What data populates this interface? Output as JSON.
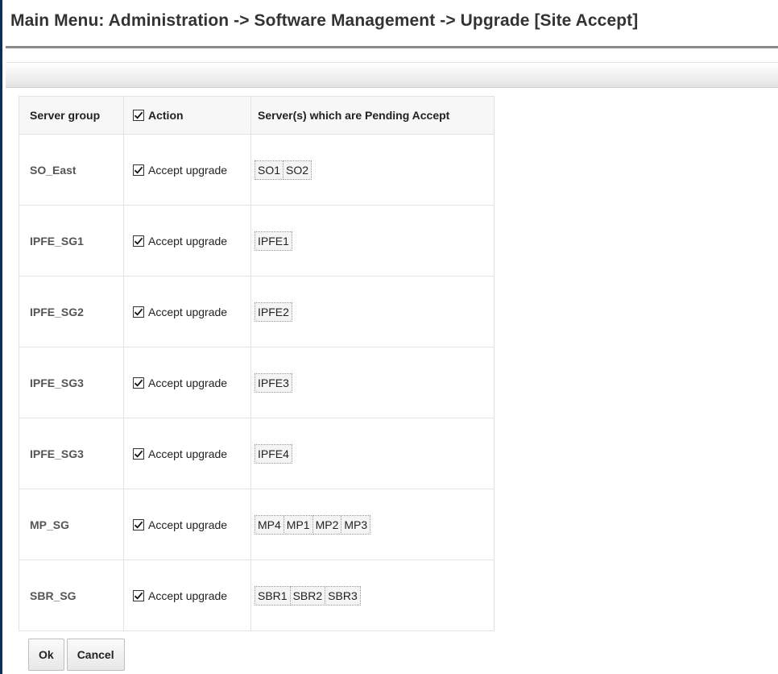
{
  "page": {
    "title": "Main Menu: Administration -> Software Management -> Upgrade [Site Accept]"
  },
  "table": {
    "headers": {
      "server_group": "Server group",
      "action": "Action",
      "pending": "Server(s) which are Pending Accept"
    },
    "header_action_checked": true,
    "rows": [
      {
        "group": "SO_East",
        "action_label": "Accept upgrade",
        "checked": true,
        "servers": [
          "SO1",
          "SO2"
        ]
      },
      {
        "group": "IPFE_SG1",
        "action_label": "Accept upgrade",
        "checked": true,
        "servers": [
          "IPFE1"
        ]
      },
      {
        "group": "IPFE_SG2",
        "action_label": "Accept upgrade",
        "checked": true,
        "servers": [
          "IPFE2"
        ]
      },
      {
        "group": "IPFE_SG3",
        "action_label": "Accept upgrade",
        "checked": true,
        "servers": [
          "IPFE3"
        ]
      },
      {
        "group": "IPFE_SG3",
        "action_label": "Accept upgrade",
        "checked": true,
        "servers": [
          "IPFE4"
        ]
      },
      {
        "group": "MP_SG",
        "action_label": "Accept upgrade",
        "checked": true,
        "servers": [
          "MP4",
          "MP1",
          "MP2",
          "MP3"
        ]
      },
      {
        "group": "SBR_SG",
        "action_label": "Accept upgrade",
        "checked": true,
        "servers": [
          "SBR1",
          "SBR2",
          "SBR3"
        ]
      }
    ]
  },
  "buttons": {
    "ok": "Ok",
    "cancel": "Cancel"
  },
  "icons": {
    "checkbox": "checkmark-icon"
  }
}
